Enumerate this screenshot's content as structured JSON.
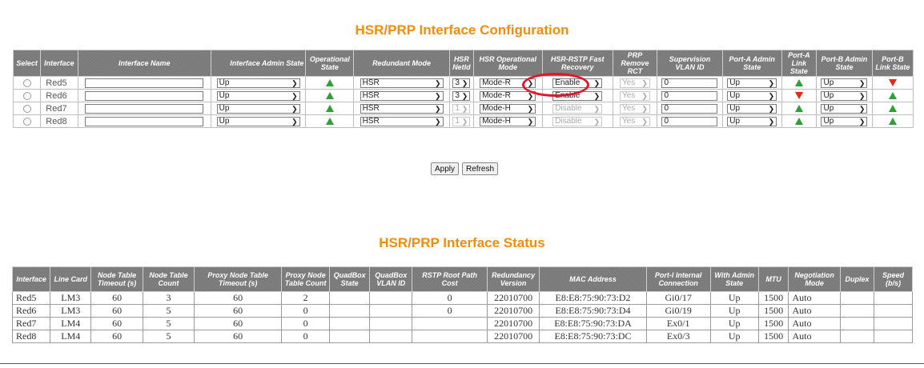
{
  "config": {
    "title": "HSR/PRP Interface Configuration",
    "headers": {
      "select": "Select",
      "interface": "Interface",
      "name": "Interface Name",
      "admin": "Interface Admin State",
      "oper": "Operational State",
      "red_mode": "Redundant Mode",
      "netid": "HSR NetId",
      "hsr_op": "HSR Operational Mode",
      "rstp": "HSR-RSTP Fast Recovery",
      "prp": "PRP Remove RCT",
      "vlan": "Supervision VLAN ID",
      "pa_admin": "Port-A Admin State",
      "pa_link": "Port-A Link State",
      "pb_admin": "Port-B Admin State",
      "pb_link": "Port-B Link State"
    },
    "rows": [
      {
        "iface": "Red5",
        "admin": "Up",
        "oper": "up",
        "mode": "HSR",
        "netid": "3",
        "hsr_op": "Mode-R",
        "rstp": "Enable",
        "prp": "Yes",
        "vlan": "0",
        "pa_admin": "Up",
        "pa_link": "up",
        "pb_admin": "Up",
        "pb_link": "down"
      },
      {
        "iface": "Red6",
        "admin": "Up",
        "oper": "up",
        "mode": "HSR",
        "netid": "3",
        "hsr_op": "Mode-R",
        "rstp": "Enable",
        "prp": "Yes",
        "vlan": "0",
        "pa_admin": "Up",
        "pa_link": "down",
        "pb_admin": "Up",
        "pb_link": "up"
      },
      {
        "iface": "Red7",
        "admin": "Up",
        "oper": "up",
        "mode": "HSR",
        "netid": "1",
        "hsr_op": "Mode-H",
        "rstp": "Disable",
        "prp": "Yes",
        "vlan": "0",
        "pa_admin": "Up",
        "pa_link": "up",
        "pb_admin": "Up",
        "pb_link": "up"
      },
      {
        "iface": "Red8",
        "admin": "Up",
        "oper": "up",
        "mode": "HSR",
        "netid": "1",
        "hsr_op": "Mode-H",
        "rstp": "Disable",
        "prp": "Yes",
        "vlan": "0",
        "pa_admin": "Up",
        "pa_link": "up",
        "pb_admin": "Up",
        "pb_link": "up"
      }
    ],
    "buttons": {
      "apply": "Apply",
      "refresh": "Refresh"
    }
  },
  "status": {
    "title": "HSR/PRP Interface Status",
    "headers": {
      "interface": "Interface",
      "line_card": "Line Card",
      "nt_timeout": "Node Table Timeout (s)",
      "nt_count": "Node Table Count",
      "pn_timeout": "Proxy Node Table Timeout (s)",
      "pn_count": "Proxy Node Table Count",
      "qb_state": "QuadBox State",
      "qb_vlan": "QuadBox VLAN ID",
      "rstp_cost": "RSTP Root Path Cost",
      "red_version": "Redundancy Version",
      "mac": "MAC Address",
      "porti": "Port-I Internal Connection",
      "with_admin": "With Admin State",
      "mtu": "MTU",
      "neg_mode": "Negotiation Mode",
      "duplex": "Duplex",
      "speed": "Speed (b/s)"
    },
    "rows": [
      {
        "iface": "Red5",
        "card": "LM3",
        "nt_timeout": "60",
        "nt_count": "3",
        "pn_timeout": "60",
        "pn_count": "2",
        "qb_state": "",
        "qb_vlan": "",
        "rstp_cost": "0",
        "version": "22010700",
        "mac": "E8:E8:75:90:73:D2",
        "porti": "Gi0/17",
        "with_admin": "Up",
        "mtu": "1500",
        "neg": "Auto",
        "duplex": "",
        "speed": ""
      },
      {
        "iface": "Red6",
        "card": "LM3",
        "nt_timeout": "60",
        "nt_count": "5",
        "pn_timeout": "60",
        "pn_count": "0",
        "qb_state": "",
        "qb_vlan": "",
        "rstp_cost": "0",
        "version": "22010700",
        "mac": "E8:E8:75:90:73:D4",
        "porti": "Gi0/19",
        "with_admin": "Up",
        "mtu": "1500",
        "neg": "Auto",
        "duplex": "",
        "speed": ""
      },
      {
        "iface": "Red7",
        "card": "LM4",
        "nt_timeout": "60",
        "nt_count": "5",
        "pn_timeout": "60",
        "pn_count": "0",
        "qb_state": "",
        "qb_vlan": "",
        "rstp_cost": "",
        "version": "22010700",
        "mac": "E8:E8:75:90:73:DA",
        "porti": "Ex0/1",
        "with_admin": "Up",
        "mtu": "1500",
        "neg": "Auto",
        "duplex": "",
        "speed": ""
      },
      {
        "iface": "Red8",
        "card": "LM4",
        "nt_timeout": "60",
        "nt_count": "5",
        "pn_timeout": "60",
        "pn_count": "0",
        "qb_state": "",
        "qb_vlan": "",
        "rstp_cost": "",
        "version": "22010700",
        "mac": "E8:E8:75:90:73:DC",
        "porti": "Ex0/3",
        "with_admin": "Up",
        "mtu": "1500",
        "neg": "Auto",
        "duplex": "",
        "speed": ""
      }
    ]
  },
  "colors": {
    "title_orange": "#f28c0a",
    "header_gray": "#7a7a7a",
    "link_up_green": "#2e9e36",
    "link_down_red": "#e52817",
    "highlight_red": "#e0162b"
  },
  "icons": {
    "link_up": "green-up-triangle-icon",
    "link_down": "red-down-triangle-icon",
    "dropdown": "chevron-down-icon"
  }
}
